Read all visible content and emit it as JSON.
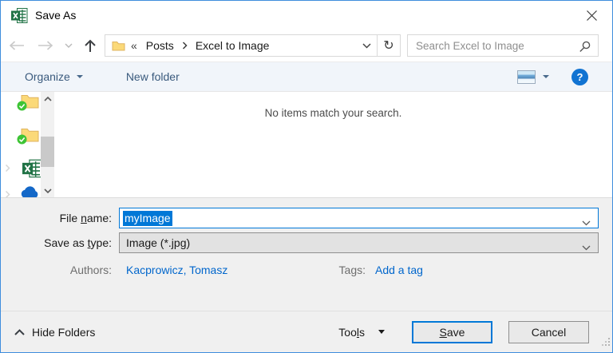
{
  "window": {
    "title": "Save As"
  },
  "icons": {
    "breadcrumb_overflow_glyph": "«",
    "refresh_glyph": "↻",
    "help_glyph": "?"
  },
  "navigation": {
    "breadcrumb": {
      "root": "Posts",
      "current": "Excel to Image"
    },
    "search": {
      "placeholder": "Search Excel to Image"
    }
  },
  "toolbar": {
    "organize_label": "Organize",
    "new_folder_label": "New folder"
  },
  "content": {
    "empty_message": "No items match your search."
  },
  "fields": {
    "file_name": {
      "label_pre": "File ",
      "label_mnemonic": "n",
      "label_post": "ame:",
      "value": "myImage"
    },
    "save_as_type": {
      "label_pre": "Save as ",
      "label_mnemonic": "t",
      "label_post": "ype:",
      "value": "Image (*.jpg)"
    },
    "authors": {
      "label": "Authors:",
      "value": "Kacprowicz, Tomasz"
    },
    "tags": {
      "label": "Tags:",
      "value": "Add a tag"
    }
  },
  "footer": {
    "hide_folders_label": "Hide Folders",
    "tools_label_pre": "Too",
    "tools_label_mnemonic": "l",
    "tools_label_post": "s",
    "save_label_pre": "",
    "save_label_mnemonic": "S",
    "save_label_post": "ave",
    "cancel_label": "Cancel"
  },
  "colors": {
    "accent": "#0078d7",
    "selection_bg": "#0078d7",
    "link_blue": "#0066cc",
    "toolbar_text": "#3a5a7d",
    "excel_green": "#217346",
    "window_border": "#3e8ddd",
    "panel_bg": "#f0f0f0"
  }
}
